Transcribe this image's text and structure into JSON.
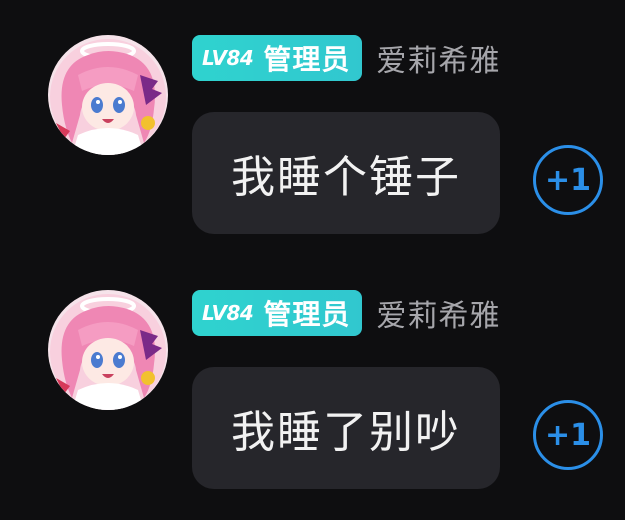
{
  "messages": [
    {
      "level": "LV84",
      "role": "管理员",
      "username": "爱莉希雅",
      "text": "我睡个锤子",
      "plus_one": "+1"
    },
    {
      "level": "LV84",
      "role": "管理员",
      "username": "爱莉希雅",
      "text": "我睡了别吵",
      "plus_one": "+1"
    }
  ],
  "colors": {
    "background": "#0e0e10",
    "badge": "#2fd3cf",
    "bubble": "#26262b",
    "accent": "#2b8fe8",
    "username": "#a6a6ab"
  },
  "icons": {
    "avatar": "anime-pink-hair-avatar"
  }
}
